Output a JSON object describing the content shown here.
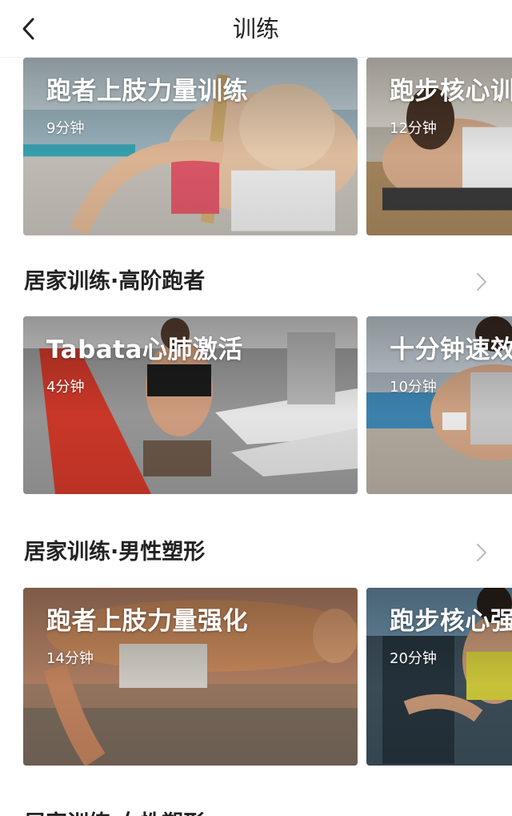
{
  "header": {
    "title": "训练"
  },
  "sections": [
    {
      "title": "",
      "cards": [
        {
          "title": "跑者上肢力量训练",
          "duration": "9分钟"
        },
        {
          "title": "跑步核心训",
          "duration": "12分钟"
        }
      ]
    },
    {
      "title": "居家训练·高阶跑者",
      "cards": [
        {
          "title": "Tabata心肺激活",
          "duration": "4分钟"
        },
        {
          "title": "十分钟速效",
          "duration": "10分钟"
        }
      ]
    },
    {
      "title": "居家训练·男性塑形",
      "cards": [
        {
          "title": "跑者上肢力量强化",
          "duration": "14分钟"
        },
        {
          "title": "跑步核心强",
          "duration": "20分钟"
        }
      ]
    },
    {
      "title": "居家训练·女性塑形",
      "cards": []
    }
  ],
  "colors": {
    "text_primary": "#222222",
    "arrow_gray": "#bbbbbb",
    "divider": "#eeeeee"
  },
  "icons": {
    "back": "chevron-left-icon",
    "section_more": "chevron-right-icon"
  }
}
